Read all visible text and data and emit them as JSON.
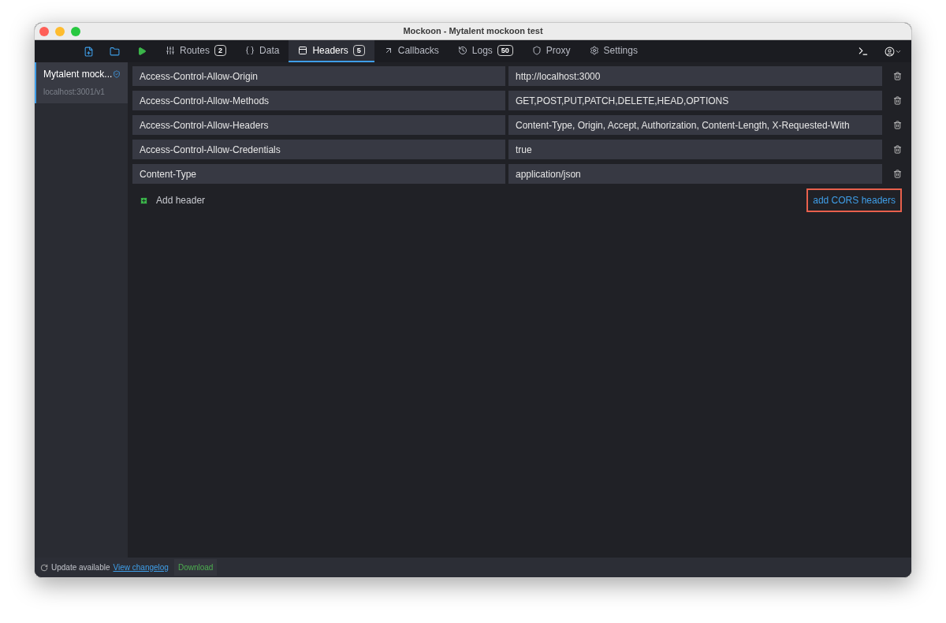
{
  "window": {
    "title": "Mockoon - Mytalent mockoon test"
  },
  "tabs": [
    {
      "kind": "routes",
      "label": "Routes",
      "badge": "2",
      "selected": false
    },
    {
      "kind": "data",
      "label": "Data",
      "selected": false
    },
    {
      "kind": "headers",
      "label": "Headers",
      "badge": "5",
      "selected": true
    },
    {
      "kind": "callbacks",
      "label": "Callbacks",
      "selected": false
    },
    {
      "kind": "logs",
      "label": "Logs",
      "badge": "50",
      "selected": false
    },
    {
      "kind": "proxy",
      "label": "Proxy",
      "selected": false
    },
    {
      "kind": "settings",
      "label": "Settings",
      "selected": false
    }
  ],
  "sidebar": {
    "items": [
      {
        "name": "Mytalent mock...",
        "address": "localhost:3001/v1",
        "selected": true,
        "https": true
      }
    ]
  },
  "headers": [
    {
      "key": "Access-Control-Allow-Origin",
      "value": "http://localhost:3000"
    },
    {
      "key": "Access-Control-Allow-Methods",
      "value": "GET,POST,PUT,PATCH,DELETE,HEAD,OPTIONS"
    },
    {
      "key": "Access-Control-Allow-Headers",
      "value": "Content-Type, Origin, Accept, Authorization, Content-Length, X-Requested-With"
    },
    {
      "key": "Access-Control-Allow-Credentials",
      "value": "true"
    },
    {
      "key": "Content-Type",
      "value": "application/json"
    }
  ],
  "add_header": {
    "label": "Add header"
  },
  "cors_button": {
    "label": "add CORS headers",
    "highlighted": true
  },
  "status_bar": {
    "message": "Update available",
    "link": "View changelog",
    "button": "Download"
  }
}
